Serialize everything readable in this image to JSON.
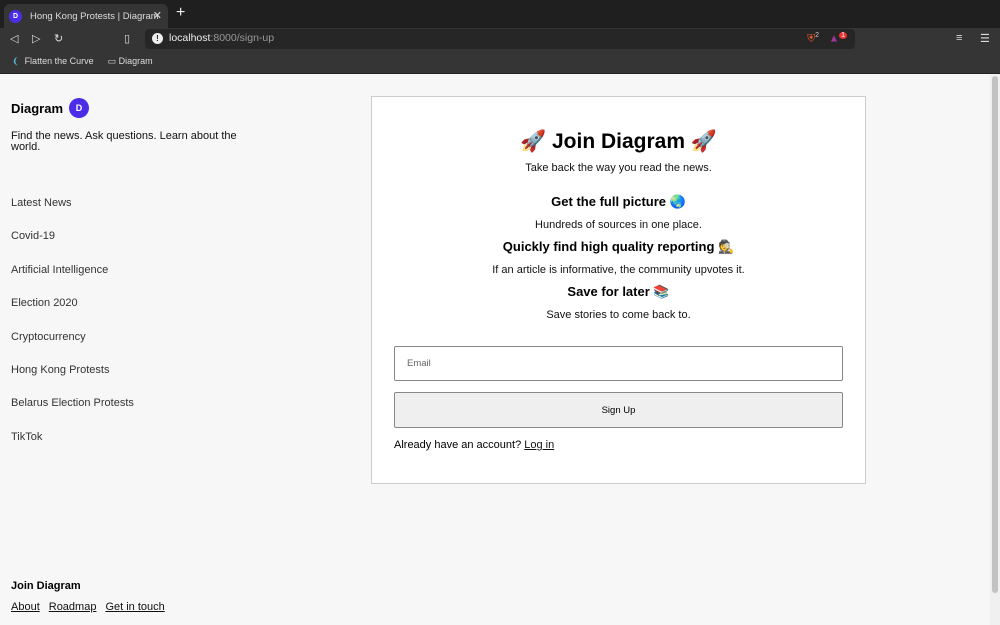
{
  "browser": {
    "tab_title": "Hong Kong Protests | Diagram",
    "url_host": "localhost",
    "url_rest": ":8000/sign-up",
    "bookmarks": [
      "Flatten the Curve",
      "Diagram"
    ],
    "shield_count": "2",
    "rewards_count": "1"
  },
  "sidebar": {
    "brand": "Diagram",
    "logo_letter": "D",
    "tagline": "Find the news. Ask questions. Learn about the world.",
    "items": [
      "Latest News",
      "Covid-19",
      "Artificial Intelligence",
      "Election 2020",
      "Cryptocurrency",
      "Hong Kong Protests",
      "Belarus Election Protests",
      "TikTok"
    ]
  },
  "footer": {
    "title": "Join Diagram",
    "links": [
      "About",
      "Roadmap",
      "Get in touch"
    ]
  },
  "card": {
    "title": "🚀 Join Diagram 🚀",
    "subtitle": "Take back the way you read the news.",
    "features": [
      {
        "title": "Get the full picture 🌏",
        "text": "Hundreds of sources in one place."
      },
      {
        "title": "Quickly find high quality reporting 🕵️",
        "text": "If an article is informative, the community upvotes it."
      },
      {
        "title": "Save for later 📚",
        "text": "Save stories to come back to."
      }
    ],
    "email_placeholder": "Email",
    "signup_label": "Sign Up",
    "login_prompt": "Already have an account?",
    "login_link": "Log in"
  }
}
